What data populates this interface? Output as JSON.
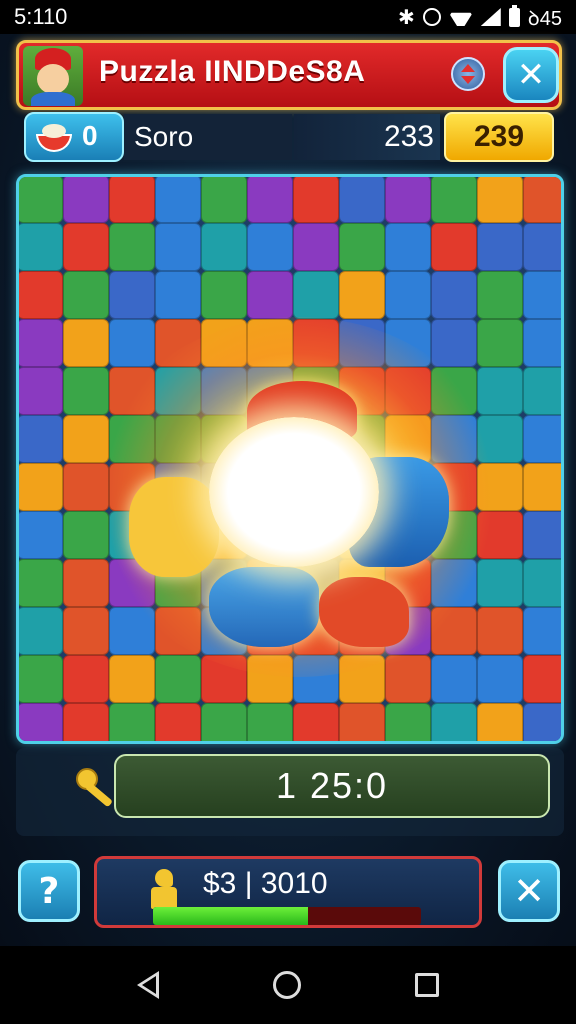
{
  "status_bar": {
    "time": "5:110",
    "right_text": "ꝺ45"
  },
  "header": {
    "title": "Puzzla IINDDeS8A"
  },
  "score_row": {
    "coins": "0",
    "player": "Soro",
    "score": "233",
    "target": "239"
  },
  "timer": {
    "value": "1 25:0"
  },
  "progress": {
    "text": "$3 | 3010",
    "fill_fraction": 0.58
  },
  "icons": {
    "avatar": "elf-avatar-icon",
    "swap": "swap-arrows-icon",
    "close": "close-icon",
    "coin": "bowl-icon",
    "key": "key-icon",
    "help": "help-icon",
    "chess": "chess-knight-icon"
  },
  "colors": {
    "title_bar": "#d01c1c",
    "accent_cyan": "#3ec0ec",
    "target": "#ffd21f",
    "progress_fill": "#3fd82a",
    "progress_track": "#5a0a0a"
  }
}
